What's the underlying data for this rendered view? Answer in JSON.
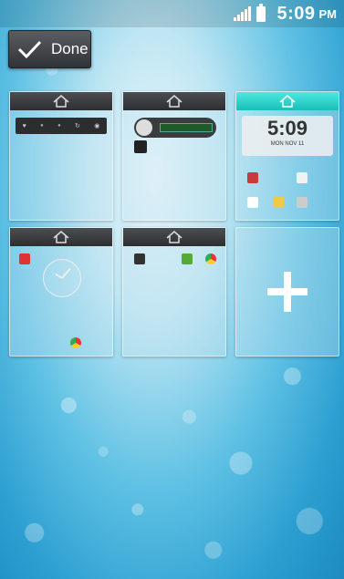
{
  "status": {
    "time": "5:09",
    "ampm": "PM"
  },
  "toolbar": {
    "done_label": "Done"
  },
  "home_widget": {
    "time": "5:09",
    "date": "MON NOV 11"
  },
  "colors": {
    "home_indicator": "#2fd3cc",
    "header_dark": "#3a3c3e"
  },
  "panels": [
    {
      "name": "panel-1"
    },
    {
      "name": "panel-2"
    },
    {
      "name": "panel-3-home"
    },
    {
      "name": "panel-4"
    },
    {
      "name": "panel-5"
    },
    {
      "name": "panel-add"
    }
  ]
}
